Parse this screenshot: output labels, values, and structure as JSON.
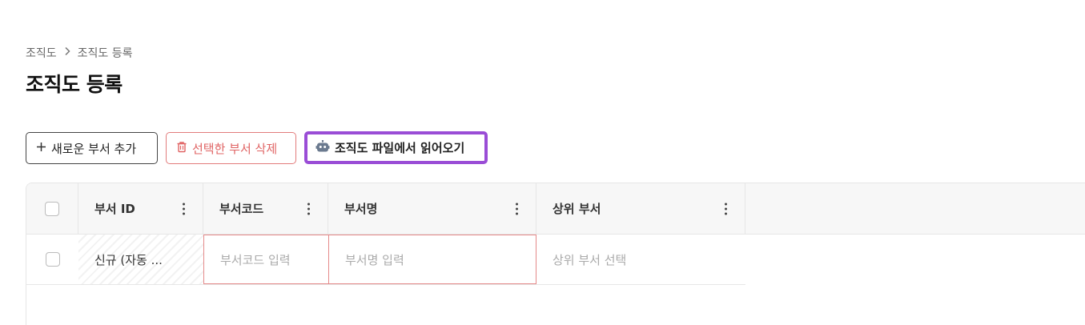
{
  "breadcrumb": {
    "root": "조직도",
    "current": "조직도 등록"
  },
  "page": {
    "title": "조직도 등록"
  },
  "toolbar": {
    "add_label": "새로운 부서 추가",
    "delete_label": "선택한 부서 삭제",
    "import_label": "조직도 파일에서 읽어오기"
  },
  "grid": {
    "columns": [
      "부서 ID",
      "부서코드",
      "부서명",
      "상위 부서"
    ],
    "rows": [
      {
        "dept_id": "신규 (자동 ...",
        "dept_code_placeholder": "부서코드 입력",
        "dept_name_placeholder": "부서명 입력",
        "parent_placeholder": "상위 부서 선택"
      }
    ]
  },
  "colors": {
    "accent_purple": "#9a4dd6",
    "danger_red": "#e06464",
    "header_bg": "#f7f7f7",
    "border": "#e6e6e6"
  }
}
